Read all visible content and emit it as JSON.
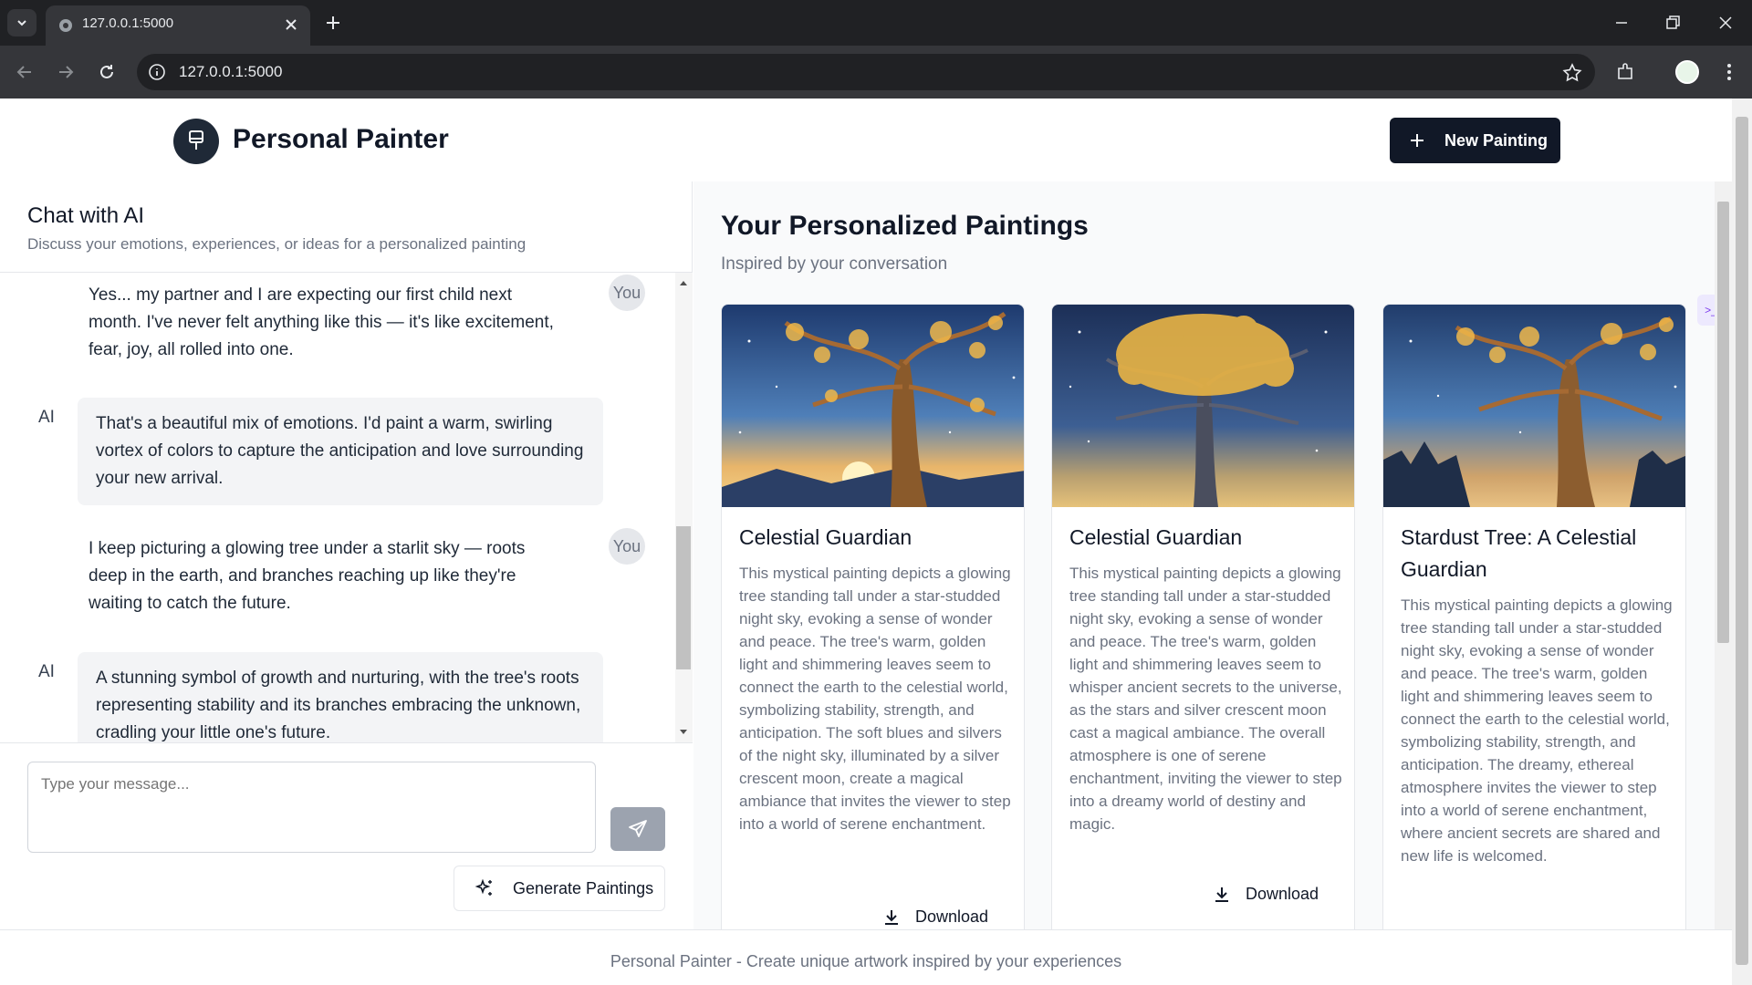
{
  "browser": {
    "tab_title": "127.0.0.1:5000",
    "url": "127.0.0.1:5000"
  },
  "header": {
    "brand": "Personal Painter",
    "new_painting_label": "New Painting"
  },
  "chat": {
    "title": "Chat with AI",
    "subtitle": "Discuss your emotions, experiences, or ideas for a personalized painting",
    "user_badge": "You",
    "ai_label": "AI",
    "messages": [
      {
        "role": "user",
        "text": "Yes... my partner and I are expecting our first child next month. I've never felt anything like this — it's like excitement, fear, joy, all rolled into one."
      },
      {
        "role": "ai",
        "text": "That's a beautiful mix of emotions. I'd paint a warm, swirling vortex of colors to capture the anticipation and love surrounding your new arrival."
      },
      {
        "role": "user",
        "text": "I keep picturing a glowing tree under a starlit sky — roots deep in the earth, and branches reaching up like they're waiting to catch the future."
      },
      {
        "role": "ai",
        "text": "A stunning symbol of growth and nurturing, with the tree's roots representing stability and its branches embracing the unknown, cradling your little one's future."
      }
    ],
    "input_placeholder": "Type your message...",
    "generate_label": "Generate Paintings"
  },
  "paintings": {
    "title": "Your Personalized Paintings",
    "subtitle": "Inspired by your conversation",
    "download_label": "Download",
    "cards": [
      {
        "title": "Celestial Guardian",
        "description": "This mystical painting depicts a glowing tree standing tall under a star-studded night sky, evoking a sense of wonder and peace. The tree's warm, golden light and shimmering leaves seem to connect the earth to the celestial world, symbolizing stability, strength, and anticipation. The soft blues and silvers of the night sky, illuminated by a silver crescent moon, create a magical ambiance that invites the viewer to step into a world of serene enchantment."
      },
      {
        "title": "Celestial Guardian",
        "description": "This mystical painting depicts a glowing tree standing tall under a star-studded night sky, evoking a sense of wonder and peace. The tree's warm, golden light and shimmering leaves seem to whisper ancient secrets to the universe, as the stars and silver crescent moon cast a magical ambiance. The overall atmosphere is one of serene enchantment, inviting the viewer to step into a dreamy world of destiny and magic."
      },
      {
        "title": "Stardust Tree: A Celestial Guardian",
        "description": "This mystical painting depicts a glowing tree standing tall under a star-studded night sky, evoking a sense of wonder and peace. The tree's warm, golden light and shimmering leaves seem to connect the earth to the celestial world, symbolizing stability, strength, and anticipation. The dreamy, ethereal atmosphere invites the viewer to step into a world of serene enchantment, where ancient secrets are shared and new life is welcomed."
      }
    ]
  },
  "footer": {
    "text": "Personal Painter - Create unique artwork inspired by your experiences"
  },
  "colors": {
    "primary": "#111827",
    "muted": "#6b7280",
    "bubble": "#f3f4f6",
    "chrome": "#202124"
  }
}
